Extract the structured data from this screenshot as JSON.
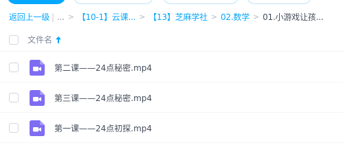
{
  "breadcrumb": {
    "back": "返回上一级",
    "ellipsis": "...",
    "crumbs": [
      "【10-1】云课...",
      "【13】芝麻学社",
      "02.数学"
    ],
    "current": "01.小游戏让孩..."
  },
  "table": {
    "column_name": "文件名",
    "sort_icon": "arrow-up-icon",
    "rows": [
      {
        "name": "第二课——24点秘密.mp4",
        "icon": "video-file-icon"
      },
      {
        "name": "第三课——24点秘密.mp4",
        "icon": "video-file-icon"
      },
      {
        "name": "第一课——24点初探.mp4",
        "icon": "video-file-icon"
      }
    ]
  },
  "colors": {
    "accent": "#06a7ff",
    "video_icon": "#7e6cf2"
  }
}
